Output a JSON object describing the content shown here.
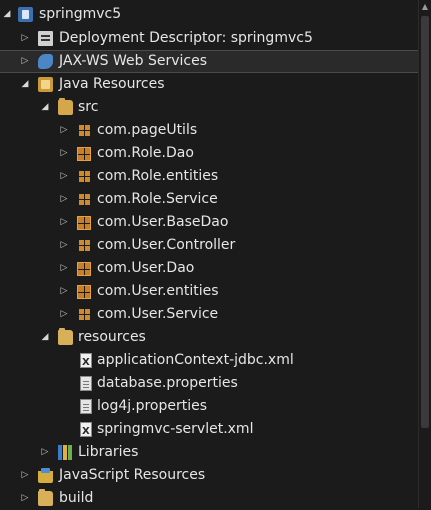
{
  "tree": {
    "items": [
      {
        "label": "springmvc5",
        "icon": "project-icon",
        "expanded": true
      },
      {
        "label": "Deployment Descriptor: springmvc5",
        "icon": "deployment-descriptor-icon",
        "expanded": false
      },
      {
        "label": "JAX-WS Web Services",
        "icon": "web-services-icon",
        "expanded": false
      },
      {
        "label": "Java Resources",
        "icon": "java-resources-icon",
        "expanded": true
      },
      {
        "label": "src",
        "icon": "source-folder-icon",
        "expanded": true
      },
      {
        "label": "com.pageUtils",
        "icon": "package-icon",
        "expanded": false
      },
      {
        "label": "com.Role.Dao",
        "icon": "package-icon",
        "expanded": false
      },
      {
        "label": "com.Role.entities",
        "icon": "package-icon",
        "expanded": false
      },
      {
        "label": "com.Role.Service",
        "icon": "package-icon",
        "expanded": false
      },
      {
        "label": "com.User.BaseDao",
        "icon": "package-icon",
        "expanded": false
      },
      {
        "label": "com.User.Controller",
        "icon": "package-icon",
        "expanded": false
      },
      {
        "label": "com.User.Dao",
        "icon": "package-icon",
        "expanded": false
      },
      {
        "label": "com.User.entities",
        "icon": "package-icon",
        "expanded": false
      },
      {
        "label": "com.User.Service",
        "icon": "package-icon",
        "expanded": false
      },
      {
        "label": "resources",
        "icon": "folder-icon",
        "expanded": true
      },
      {
        "label": "applicationContext-jdbc.xml",
        "icon": "xml-file-icon"
      },
      {
        "label": "database.properties",
        "icon": "properties-file-icon"
      },
      {
        "label": "log4j.properties",
        "icon": "properties-file-icon"
      },
      {
        "label": "springmvc-servlet.xml",
        "icon": "xml-file-icon"
      },
      {
        "label": "Libraries",
        "icon": "libraries-icon",
        "expanded": false
      },
      {
        "label": "JavaScript Resources",
        "icon": "javascript-resources-icon",
        "expanded": false
      },
      {
        "label": "build",
        "icon": "folder-icon",
        "expanded": false
      }
    ]
  },
  "colors": {
    "background": "#1b1b1c",
    "text": "#e6e6e6",
    "selection": "#2a2a2b"
  }
}
